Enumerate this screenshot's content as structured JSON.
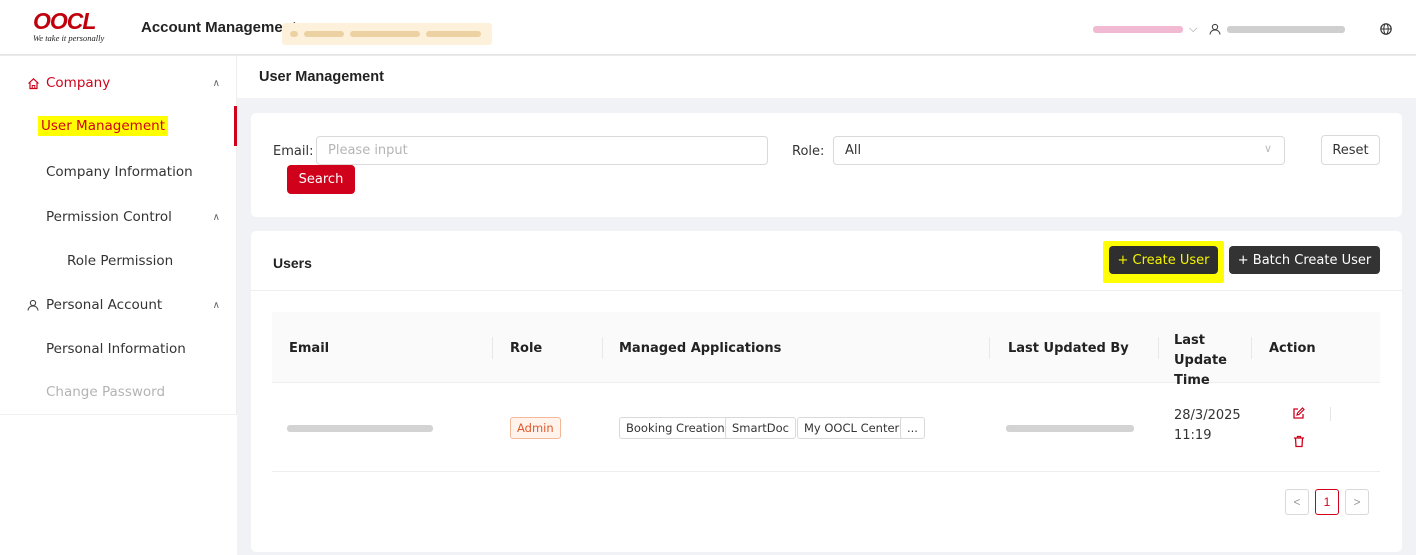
{
  "header": {
    "logo_text": "OOCL",
    "logo_tagline": "We take it personally",
    "app_title": "Account Management"
  },
  "sidebar": {
    "company": "Company",
    "user_management": "User Management",
    "company_information": "Company Information",
    "permission_control": "Permission Control",
    "role_permission": "Role Permission",
    "personal_account": "Personal Account",
    "personal_information": "Personal Information",
    "change_password": "Change Password"
  },
  "page": {
    "title": "User Management"
  },
  "filter": {
    "email_label": "Email:",
    "email_placeholder": "Please input",
    "role_label": "Role:",
    "role_value": "All",
    "reset_label": "Reset",
    "search_label": "Search"
  },
  "users": {
    "title": "Users",
    "create_user": "+ Create User",
    "batch_create_user": "+ Batch Create User",
    "columns": [
      "Email",
      "Role",
      "Managed Applications",
      "Last Updated By",
      "Last Update Time",
      "Action"
    ],
    "rows": [
      {
        "role": "Admin",
        "applications": [
          "Booking Creation",
          "SmartDoc",
          "My OOCL Center",
          "..."
        ],
        "last_update_date": "28/3/2025",
        "last_update_time": "11:19"
      }
    ],
    "pagination": {
      "prev": "<",
      "current": "1",
      "next": ">"
    }
  },
  "colors": {
    "brand_red": "#d0021b",
    "highlight_yellow": "#ffff00",
    "dark_button": "#333333"
  }
}
